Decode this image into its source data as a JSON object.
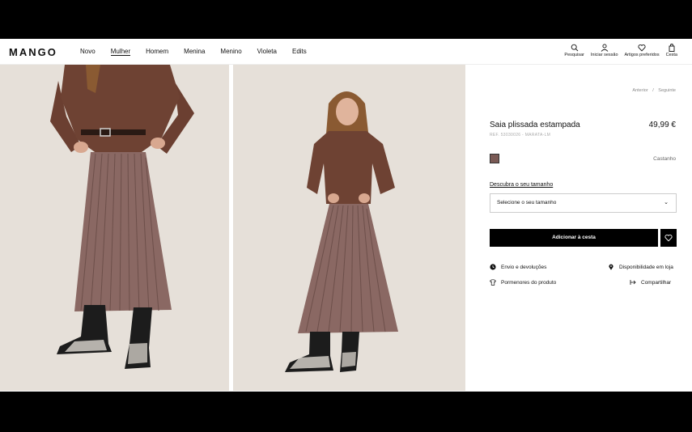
{
  "brand": "MANGO",
  "nav": [
    "Novo",
    "Mulher",
    "Homem",
    "Menina",
    "Menino",
    "Violeta",
    "Edits"
  ],
  "nav_active": "Mulher",
  "tools": {
    "search": "Pesquisar",
    "login": "Iniciar sessão",
    "favorites": "Artigos preferidos",
    "cart": "Cesta"
  },
  "breadcrumb": {
    "prev": "Anterior",
    "sep": "/",
    "next": "Seguinte"
  },
  "product": {
    "title": "Saia plissada estampada",
    "price": "49,99 €",
    "ref": "REF. 53030026 - MARATA-LM",
    "color_name": "Castanho",
    "color_hex": "#7a5a55",
    "size_guide": "Descubra o seu tamanho",
    "size_placeholder": "Selecione o seu tamanho",
    "add_to_cart": "Adicionar à cesta"
  },
  "links": {
    "shipping": "Envio e devoluções",
    "store": "Disponibilidade em loja",
    "details": "Pormenores do produto",
    "share": "Compartilhar"
  },
  "colors": {
    "sweater": "#6e4233",
    "skirt": "#8a6863",
    "background": "#e6e0d9"
  }
}
